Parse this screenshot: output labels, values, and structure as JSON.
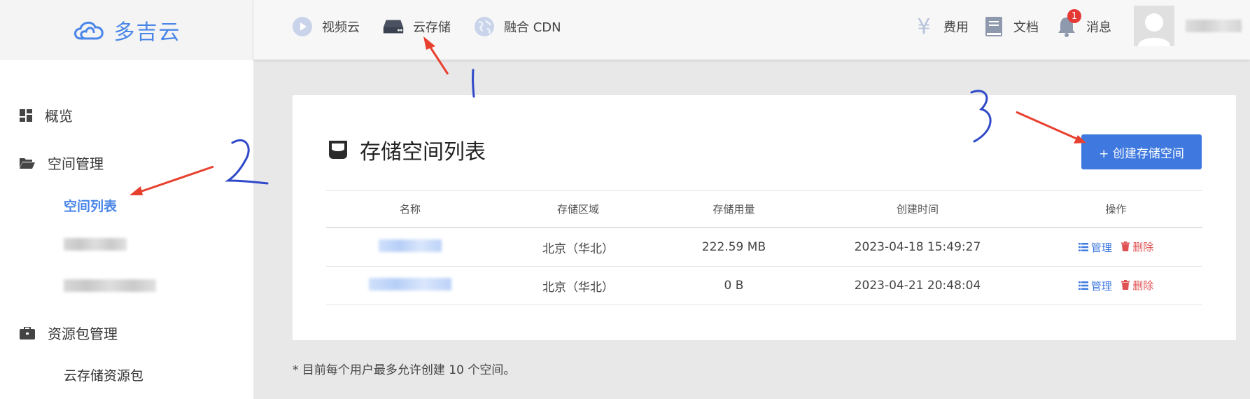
{
  "logo": {
    "text": "多吉云"
  },
  "topnav": {
    "items": [
      {
        "label": "视频云",
        "icon": "play-circle-icon"
      },
      {
        "label": "云存储",
        "icon": "storage-drive-icon"
      },
      {
        "label": "融合 CDN",
        "icon": "globe-icon"
      }
    ],
    "right": [
      {
        "label": "费用",
        "icon": "yen-icon"
      },
      {
        "label": "文档",
        "icon": "book-icon"
      },
      {
        "label": "消息",
        "icon": "bell-icon",
        "badge": "1"
      }
    ]
  },
  "sidebar": {
    "items": [
      {
        "label": "概览",
        "icon": "dashboard-icon"
      },
      {
        "label": "空间管理",
        "icon": "folder-open-icon"
      },
      {
        "label": "资源包管理",
        "icon": "briefcase-icon"
      }
    ],
    "sub": {
      "space_list": "空间列表",
      "storage_package": "云存储资源包"
    }
  },
  "panel": {
    "title": "存储空间列表",
    "create_button": "+ 创建存储空间",
    "columns": [
      "名称",
      "存储区域",
      "存储用量",
      "创建时间",
      "操作"
    ],
    "rows": [
      {
        "region": "北京（华北）",
        "usage": "222.59 MB",
        "created": "2023-04-18 15:49:27"
      },
      {
        "region": "北京（华北）",
        "usage": "0 B",
        "created": "2023-04-21 20:48:04"
      }
    ],
    "actions": {
      "manage": "管理",
      "delete": "删除"
    }
  },
  "footnote": "* 目前每个用户最多允许创建 10 个空间。",
  "colors": {
    "accent": "#3f79df",
    "danger": "#e05252",
    "annotation_blue": "#2f49c9",
    "annotation_red": "#e8402f"
  }
}
